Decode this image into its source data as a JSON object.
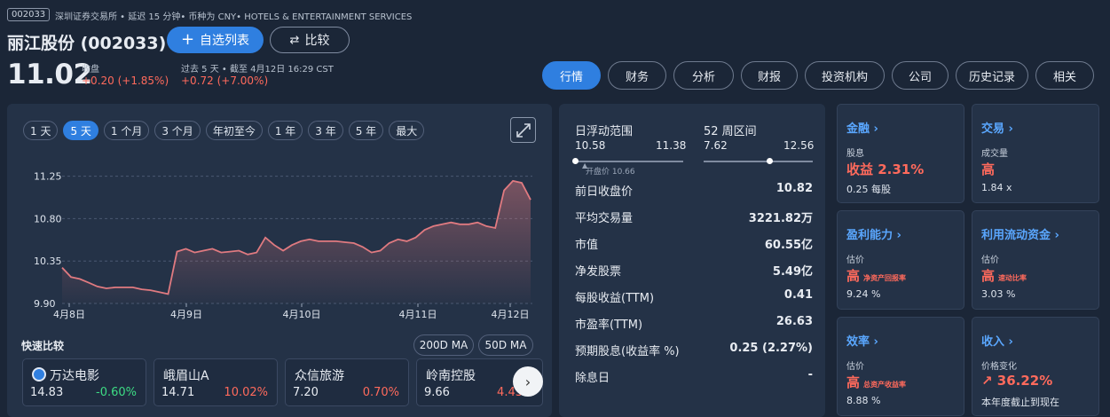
{
  "header": {
    "ticker_badge": "002033",
    "exchange_line": "深圳证券交易所 • 延迟 15 分钟• 币种为 CNY• HOTELS & ENTERTAINMENT SERVICES",
    "title": "丽江股份 (002033)",
    "watch_button": "自选列表",
    "compare_button": "比较",
    "price": "11.02",
    "close_label": "收盘",
    "close_change": "+0.20 (+1.85%)",
    "after_label": "过去 5 天 • 截至 4月12日 16:29 CST",
    "after_change": "+0.72 (+7.00%)"
  },
  "nav_tabs": [
    "行情",
    "财务",
    "分析",
    "财报",
    "投资机构",
    "公司",
    "历史记录",
    "相关"
  ],
  "ranges": [
    "1 天",
    "5 天",
    "1 个月",
    "3 个月",
    "年初至今",
    "1 年",
    "3 年",
    "5 年",
    "最大"
  ],
  "chart_data": {
    "type": "line",
    "x_labels": [
      "4月8日",
      "4月9日",
      "4月10日",
      "4月11日",
      "4月12日"
    ],
    "y_ticks": [
      "11.25",
      "10.80",
      "10.35",
      "9.90"
    ],
    "ylim": [
      9.9,
      11.35
    ],
    "values": [
      10.28,
      10.18,
      10.16,
      10.12,
      10.08,
      10.06,
      10.07,
      10.07,
      10.07,
      10.05,
      10.04,
      10.02,
      10.0,
      10.45,
      10.48,
      10.44,
      10.46,
      10.48,
      10.44,
      10.45,
      10.46,
      10.42,
      10.44,
      10.6,
      10.52,
      10.46,
      10.52,
      10.56,
      10.58,
      10.56,
      10.56,
      10.56,
      10.55,
      10.54,
      10.5,
      10.44,
      10.46,
      10.54,
      10.58,
      10.56,
      10.6,
      10.68,
      10.72,
      10.74,
      10.76,
      10.74,
      10.74,
      10.76,
      10.72,
      10.7,
      11.1,
      11.2,
      11.18,
      11.0
    ]
  },
  "quick_compare": {
    "label": "快速比较",
    "ma200": "200D MA",
    "ma50": "50D MA",
    "peers": [
      {
        "name": "万达电影",
        "price": "14.83",
        "change": "-0.60%"
      },
      {
        "name": "峨眉山A",
        "price": "14.71",
        "change": "10.02%"
      },
      {
        "name": "众信旅游",
        "price": "7.20",
        "change": "0.70%"
      },
      {
        "name": "岭南控股",
        "price": "9.66",
        "change": "4.43"
      }
    ]
  },
  "stats": {
    "day_range_label": "日浮动范围",
    "day_low": "10.58",
    "day_high": "11.38",
    "week52_label": "52 周区间",
    "week52_low": "7.62",
    "week52_high": "12.56",
    "open_label": "开盘价 10.66",
    "rows": [
      {
        "label": "前日收盘价",
        "value": "10.82"
      },
      {
        "label": "平均交易量",
        "value": "3221.82万"
      },
      {
        "label": "市值",
        "value": "60.55亿"
      },
      {
        "label": "净发股票",
        "value": "5.49亿"
      },
      {
        "label": "每股收益(TTM)",
        "value": "0.41"
      },
      {
        "label": "市盈率(TTM)",
        "value": "26.63"
      },
      {
        "label": "预期股息(收益率 %)",
        "value": "0.25 (2.27%)"
      },
      {
        "label": "除息日",
        "value": "-"
      }
    ]
  },
  "cards": [
    {
      "title": "金融 ›",
      "sub": "股息",
      "main": "收益 2.31%",
      "main_note": "",
      "foot": "0.25 每股"
    },
    {
      "title": "交易 ›",
      "sub": "成交量",
      "main": "高",
      "main_note": "",
      "foot": "1.84 x"
    },
    {
      "title": "盈利能力 ›",
      "sub": "估价",
      "main": "高",
      "main_note": "净资产回报率",
      "foot": "9.24 %"
    },
    {
      "title": "利用流动资金 ›",
      "sub": "估价",
      "main": "高",
      "main_note": "速动比率",
      "foot": "3.03 %"
    },
    {
      "title": "效率 ›",
      "sub": "估价",
      "main": "高",
      "main_note": "总资产收益率",
      "foot": "8.88 %"
    },
    {
      "title": "收入 ›",
      "sub": "价格变化",
      "main": "↗ 36.22%",
      "main_note": "",
      "foot": "本年度截止到现在"
    }
  ],
  "colors": {
    "accent": "#2f7fe0",
    "up": "#ff6a5c",
    "down": "#3ddc84",
    "line": "#e07a80"
  }
}
